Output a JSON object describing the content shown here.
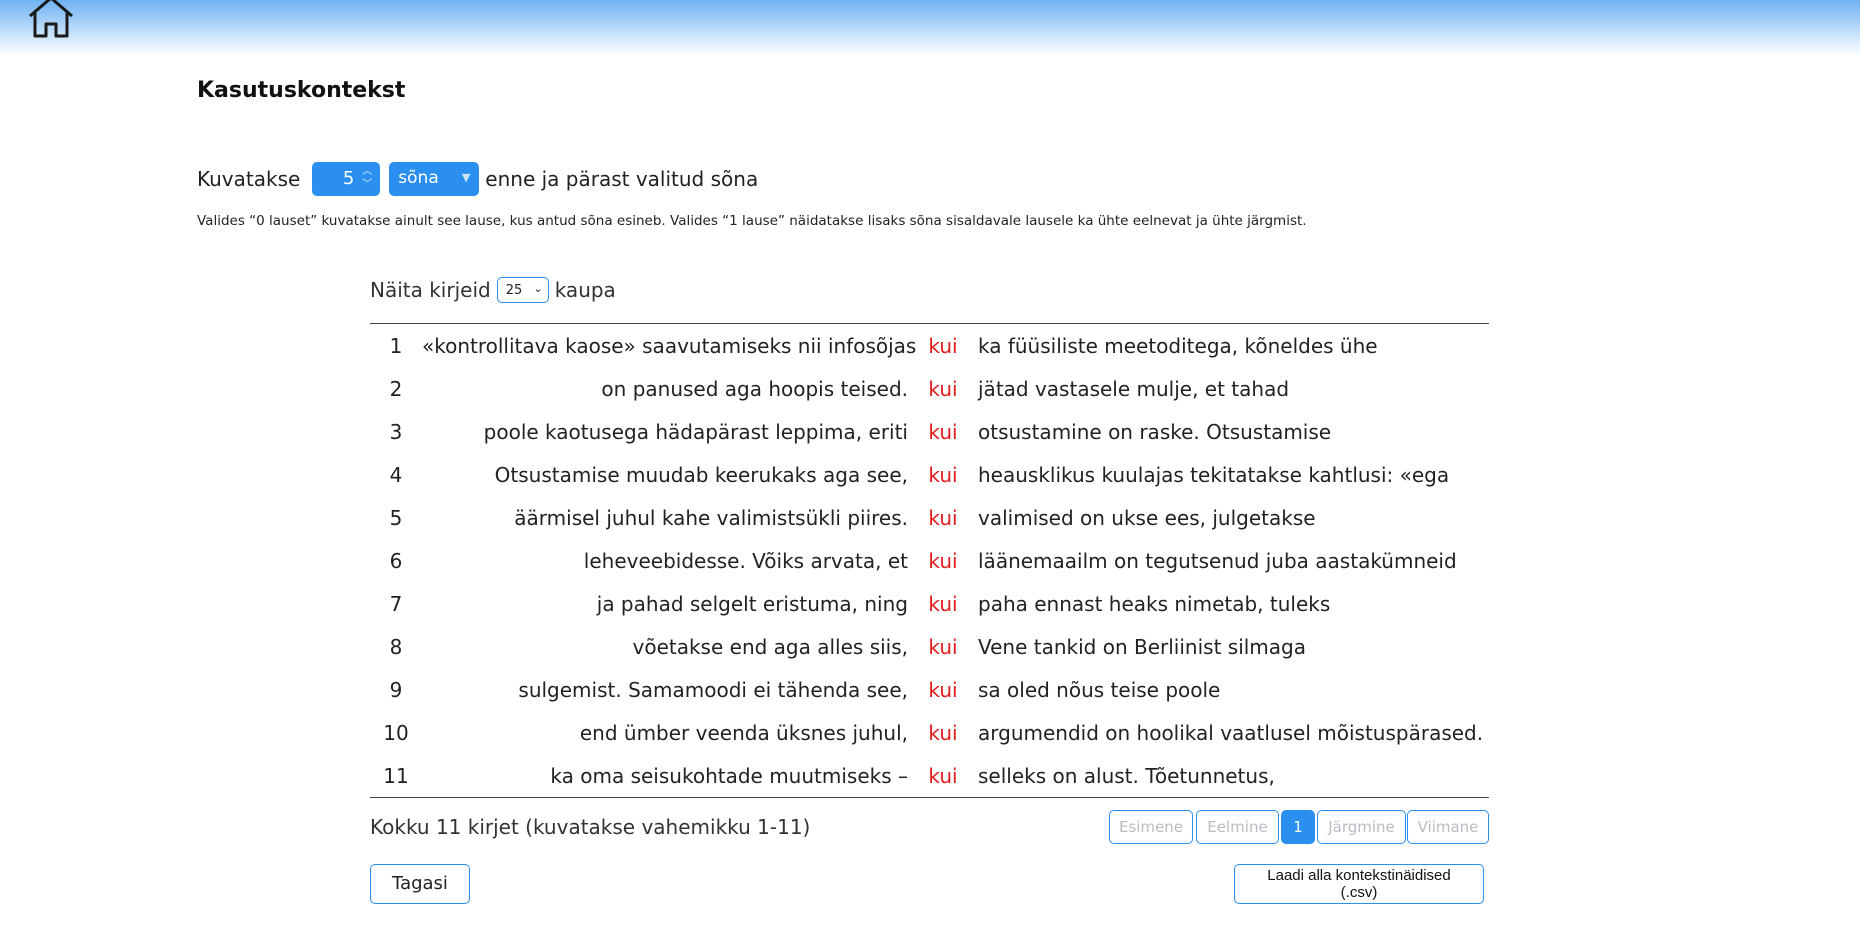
{
  "header": {
    "home_icon": "home-icon"
  },
  "page_title": "Kasutuskontekst",
  "context_controls": {
    "prefix": "Kuvatakse",
    "count_value": "5",
    "unit_value": "sõna",
    "suffix": "enne ja pärast valitud sõna"
  },
  "hint": "Valides “0 lauset” kuvatakse ainult see lause, kus antud sõna esineb. Valides “1 lause” näidatakse lisaks sõna sisaldavale lausele ka ühte eelnevat ja ühte järgmist.",
  "page_size": {
    "label_before": "Näita kirjeid",
    "value": "25",
    "label_after": "kaupa"
  },
  "rows": [
    {
      "num": "1",
      "left": "«kontrollitava kaose» saavutamiseks nii infosõjas",
      "keyword": "kui",
      "right": "ka füüsiliste meetoditega, kõneldes ühe"
    },
    {
      "num": "2",
      "left": "on panused aga hoopis teised.",
      "keyword": "kui",
      "right": "jätad vastasele mulje, et tahad"
    },
    {
      "num": "3",
      "left": "poole kaotusega hädapärast leppima, eriti",
      "keyword": "kui",
      "right": "otsustamine on raske. Otsustamise"
    },
    {
      "num": "4",
      "left": "Otsustamise muudab keerukaks aga see,",
      "keyword": "kui",
      "right": "heausklikus kuulajas tekitatakse kahtlusi: «ega"
    },
    {
      "num": "5",
      "left": "äärmisel juhul kahe valimistsükli piires.",
      "keyword": "kui",
      "right": "valimised on ukse ees, julgetakse"
    },
    {
      "num": "6",
      "left": "leheveebidesse. Võiks arvata, et",
      "keyword": "kui",
      "right": "läänemaailm on tegutsenud juba aastakümneid"
    },
    {
      "num": "7",
      "left": "ja pahad selgelt eristuma, ning",
      "keyword": "kui",
      "right": "paha ennast heaks nimetab, tuleks"
    },
    {
      "num": "8",
      "left": "võetakse end aga alles siis,",
      "keyword": "kui",
      "right": "Vene tankid on Berliinist silmaga"
    },
    {
      "num": "9",
      "left": "sulgemist. Samamoodi ei tähenda see,",
      "keyword": "kui",
      "right": "sa oled nõus teise poole"
    },
    {
      "num": "10",
      "left": "end ümber veenda üksnes juhul,",
      "keyword": "kui",
      "right": "argumendid on hoolikal vaatlusel mõistuspärased."
    },
    {
      "num": "11",
      "left": "ka oma seisukohtade muutmiseks –",
      "keyword": "kui",
      "right": "selleks on alust. Tõetunnetus,"
    }
  ],
  "summary": "Kokku 11 kirjet (kuvatakse vahemikku 1-11)",
  "pagination": {
    "first": "Esimene",
    "prev": "Eelmine",
    "current": "1",
    "next": "Järgmine",
    "last": "Viimane"
  },
  "buttons": {
    "back": "Tagasi",
    "download_line1": "Laadi alla kontekstinäidised",
    "download_line2": "(.csv)"
  },
  "colors": {
    "accent": "#2b8ff0",
    "keyword": "#e41b1b"
  }
}
